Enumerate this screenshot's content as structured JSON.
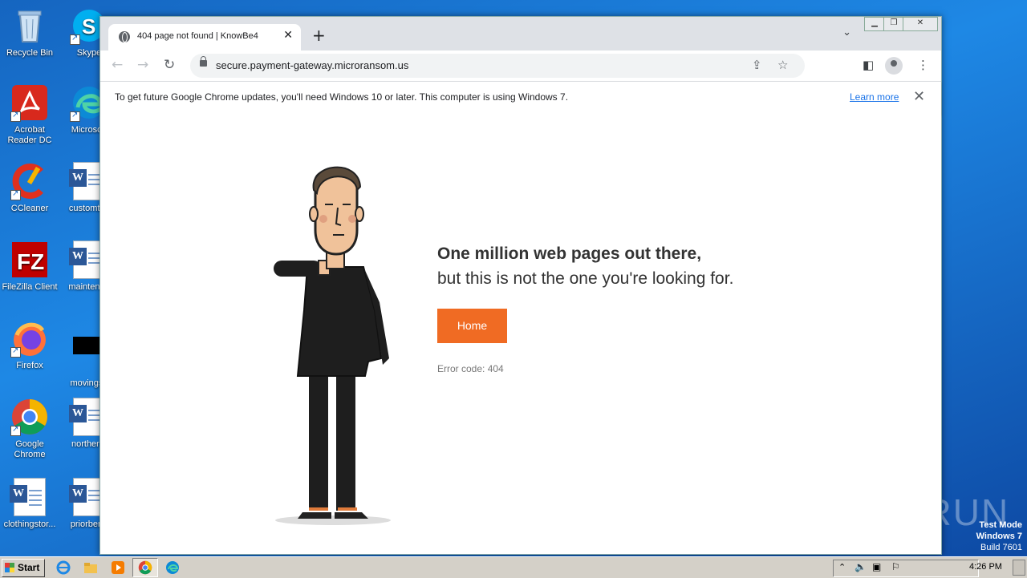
{
  "desktop": {
    "icons_left": [
      {
        "label": "Recycle Bin"
      },
      {
        "label": "Acrobat Reader DC"
      },
      {
        "label": "CCleaner"
      },
      {
        "label": "FileZilla Client"
      },
      {
        "label": "Firefox"
      },
      {
        "label": "Google Chrome"
      },
      {
        "label": "clothingstor..."
      }
    ],
    "icons_right": [
      {
        "label": "Skype"
      },
      {
        "label": "Microsoft"
      },
      {
        "label": "customtes"
      },
      {
        "label": "maintenan"
      },
      {
        "label": "movingsu"
      },
      {
        "label": "northernt"
      },
      {
        "label": "priorbene"
      }
    ],
    "watermark": "ANY RUN",
    "test_mode": {
      "line1": "Test Mode",
      "line2": "Windows 7",
      "line3": "Build 7601"
    }
  },
  "browser": {
    "tab": {
      "title": "404 page not found | KnowBe4",
      "close": "✕"
    },
    "new_tab": "+",
    "address": {
      "url": "secure.payment-gateway.microransom.us"
    },
    "infobar": {
      "message": "To get future Google Chrome updates, you'll need Windows 10 or later. This computer is using Windows 7.",
      "link": "Learn more",
      "close": "✕"
    }
  },
  "page": {
    "headline": "One million web pages out there,",
    "subline": "but this is not the one you're looking for.",
    "home_button": "Home",
    "error_code": "Error code: 404"
  },
  "taskbar": {
    "start": "Start",
    "clock": "4:26 PM"
  },
  "colors": {
    "accent": "#f06b23",
    "link": "#1a73e8"
  }
}
